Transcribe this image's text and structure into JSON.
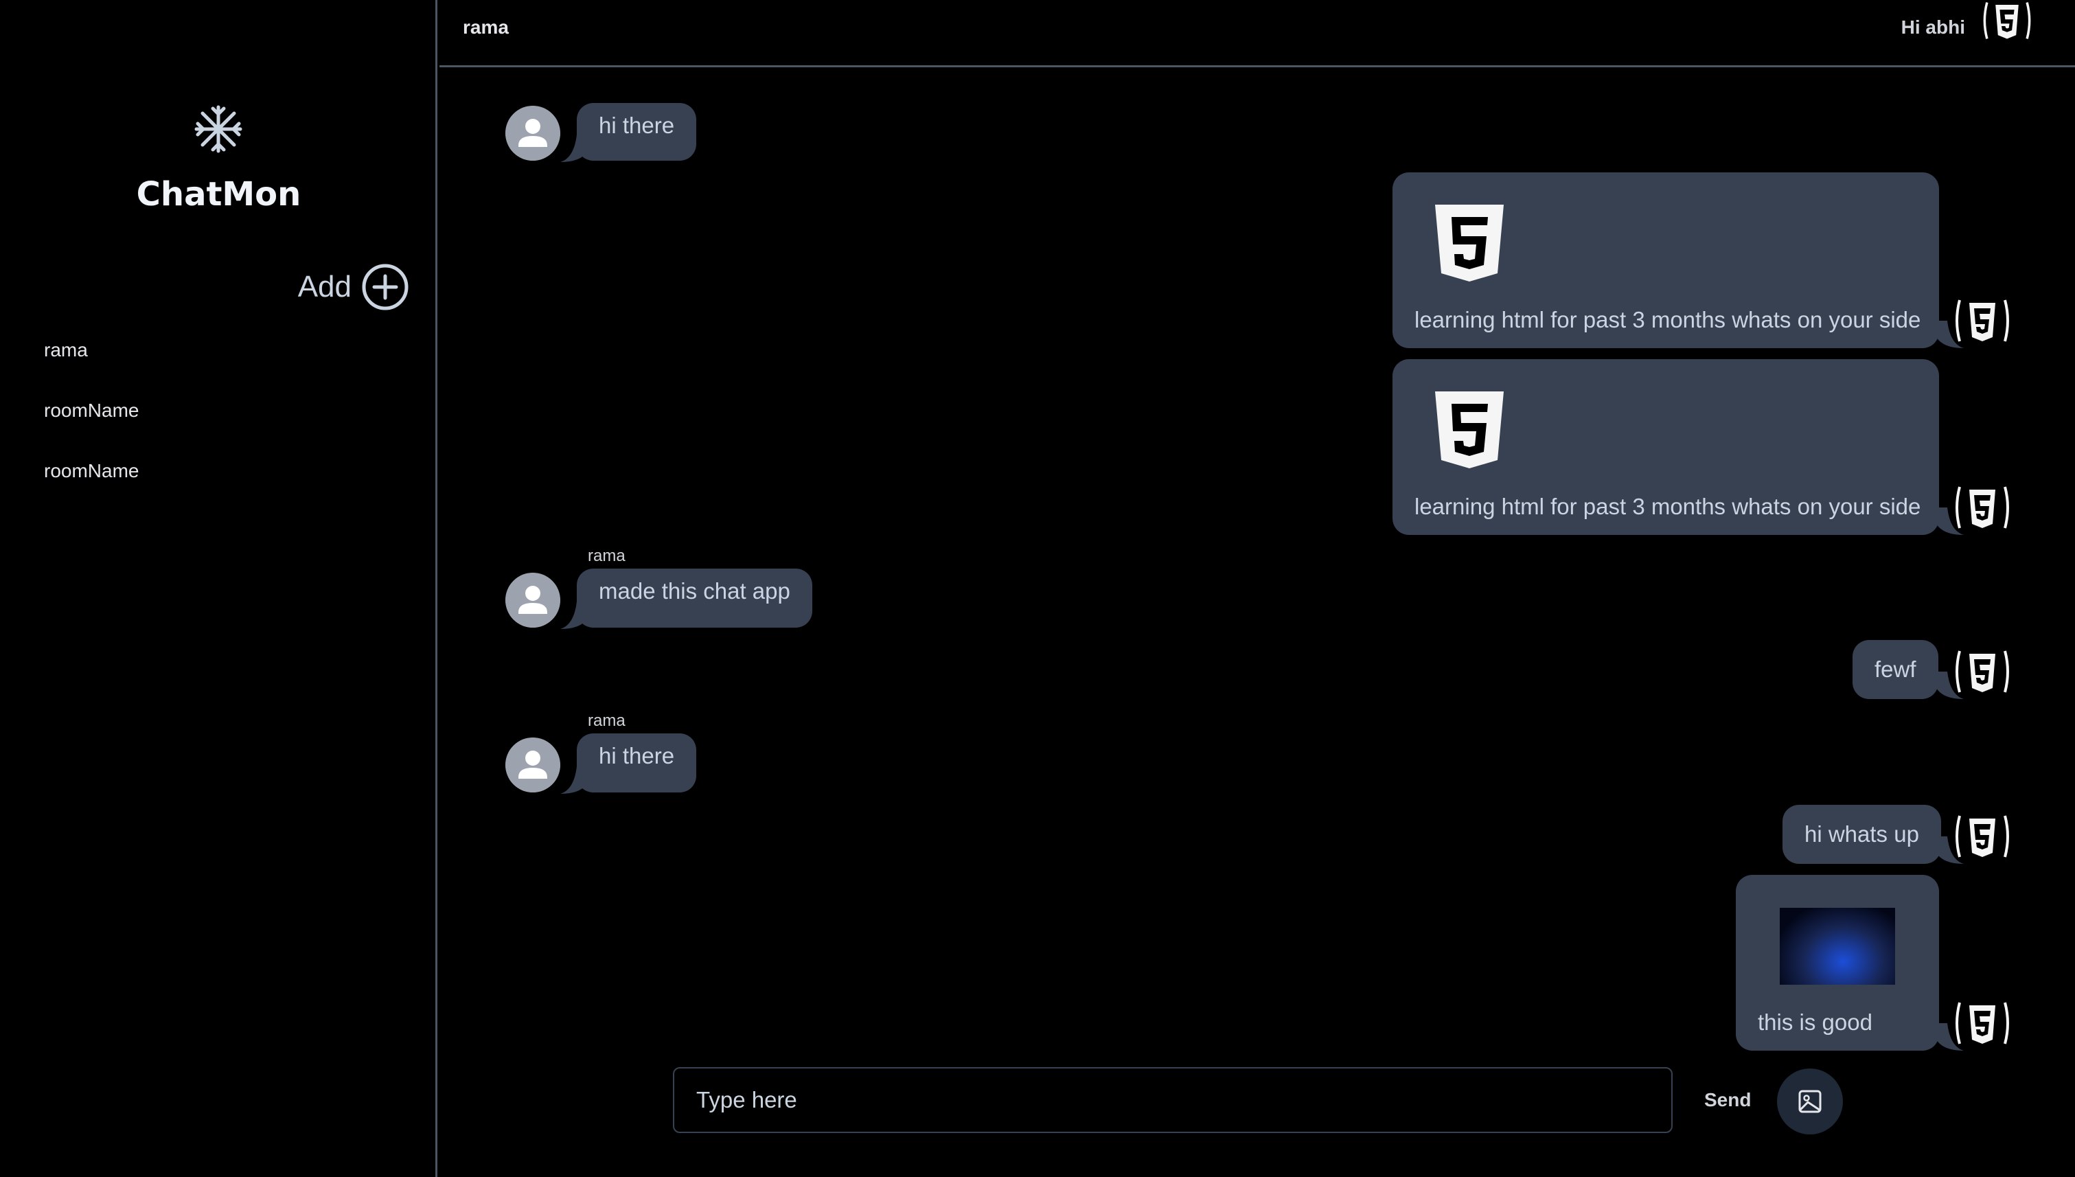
{
  "sidebar": {
    "brand": "ChatMon",
    "add_label": "Add",
    "rooms": [
      {
        "label": "rama"
      },
      {
        "label": "roomName"
      },
      {
        "label": "roomName"
      }
    ]
  },
  "header": {
    "room_name": "rama",
    "greeting": "Hi abhi"
  },
  "messages": [
    {
      "direction": "incoming",
      "sender": "",
      "text": "hi there"
    },
    {
      "direction": "outgoing",
      "attachment": "html5-logo",
      "text": "learning html for past 3 months whats on your side"
    },
    {
      "direction": "outgoing",
      "attachment": "html5-logo",
      "text": "learning html for past 3 months whats on your side"
    },
    {
      "direction": "incoming",
      "sender": "rama",
      "text": "made this chat app"
    },
    {
      "direction": "outgoing",
      "text": "fewf"
    },
    {
      "direction": "incoming",
      "sender": "rama",
      "text": "hi there"
    },
    {
      "direction": "outgoing",
      "text": "hi whats up"
    },
    {
      "direction": "outgoing",
      "attachment": "blue-image",
      "text": "this is good"
    }
  ],
  "composer": {
    "placeholder": "Type here",
    "value": "",
    "send_label": "Send"
  },
  "colors": {
    "background": "#000000",
    "bubble": "#374151",
    "divider": "#4b5563",
    "avatar_gray": "#9ca3af",
    "accent_blue": "#1d4ed8"
  },
  "icons": {
    "logo": "snowflake-icon",
    "add": "plus-circle-icon",
    "user_avatar": "user-silhouette-icon",
    "self_avatar": "html5-icon",
    "image_upload": "image-icon"
  }
}
